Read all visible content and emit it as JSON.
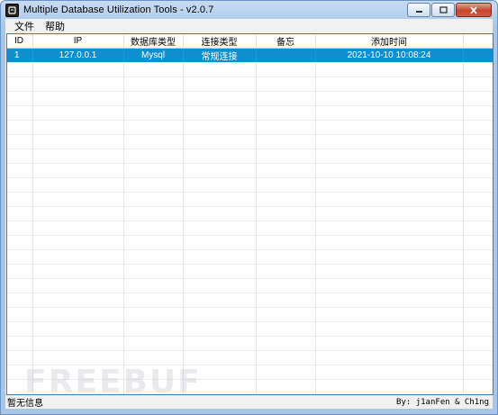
{
  "window": {
    "title": "Multiple Database Utilization Tools - v2.0.7",
    "icon": "app-icon"
  },
  "menu": [
    {
      "label": "文件"
    },
    {
      "label": "帮助"
    }
  ],
  "table": {
    "columns": [
      "ID",
      "IP",
      "数据库类型",
      "连接类型",
      "备忘",
      "添加时间",
      ""
    ],
    "rows": [
      {
        "id": "1",
        "ip": "127.0.0.1",
        "db_type": "Mysql",
        "conn_type": "常规连接",
        "memo": "",
        "added": "2021-10-10 10:08:24",
        "extra": "",
        "selected": true
      }
    ]
  },
  "status": {
    "left": "暂无信息",
    "right": "By: j1anFen & Ch1ng"
  },
  "watermark": "FREEBUF",
  "colors": {
    "selection": "#0f8fd0",
    "title_bar": "#a9c6e6",
    "close_button": "#c8432b"
  }
}
